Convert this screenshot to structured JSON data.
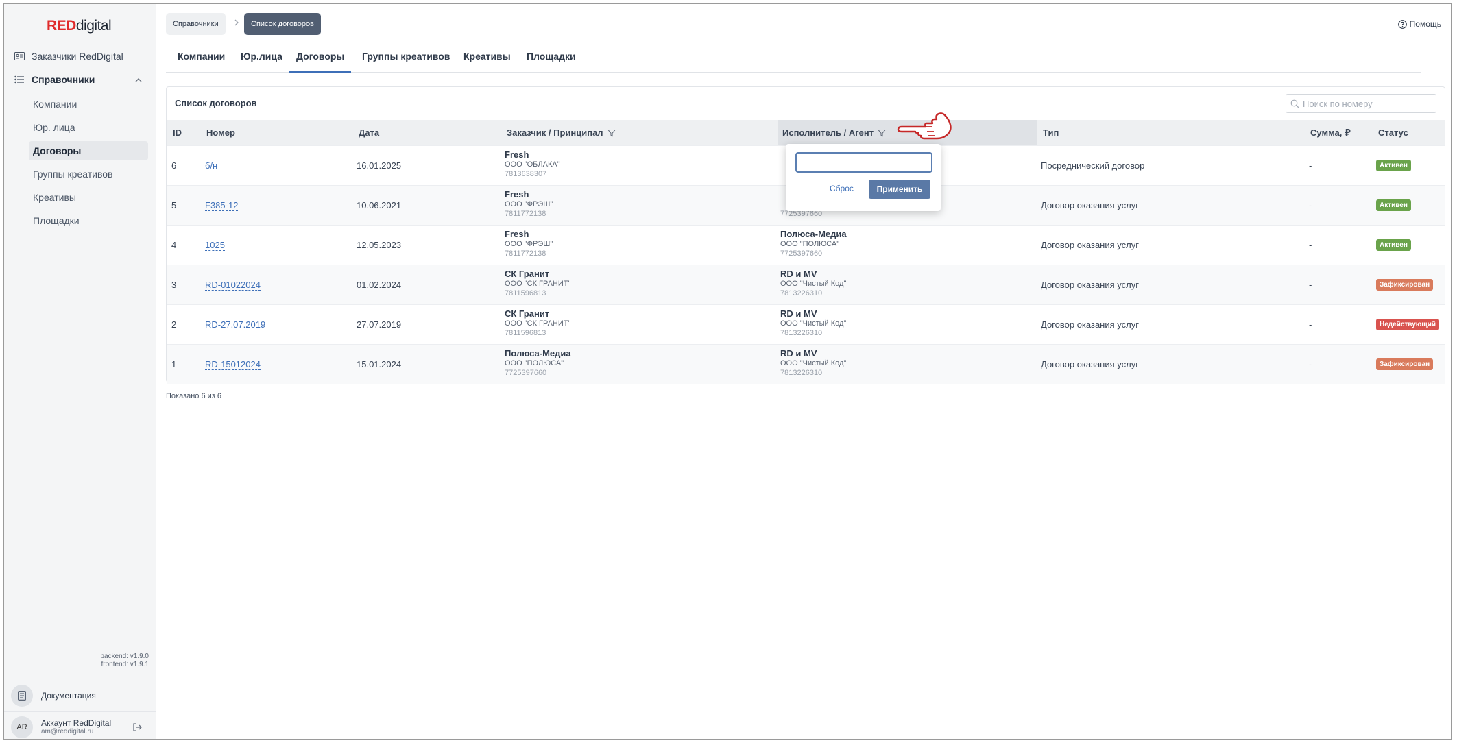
{
  "brand": {
    "logo_red": "RED",
    "logo_rest": "digital"
  },
  "sidebar": {
    "customers_label": "Заказчики RedDigital",
    "group_label": "Справочники",
    "items": [
      {
        "label": "Компании"
      },
      {
        "label": "Юр. лица"
      },
      {
        "label": "Договоры"
      },
      {
        "label": "Группы креативов"
      },
      {
        "label": "Креативы"
      },
      {
        "label": "Площадки"
      }
    ],
    "backend_version": "backend: v1.9.0",
    "frontend_version": "frontend: v1.9.1",
    "docs_label": "Документация",
    "account_initials": "AR",
    "account_name": "Аккаунт RedDigital",
    "account_email": "am@reddigital.ru"
  },
  "breadcrumb": {
    "root": "Справочники",
    "current": "Список договоров"
  },
  "help_label": "Помощь",
  "tabs": [
    {
      "label": "Компании"
    },
    {
      "label": "Юр.лица"
    },
    {
      "label": "Договоры"
    },
    {
      "label": "Группы креативов"
    },
    {
      "label": "Креативы"
    },
    {
      "label": "Площадки"
    }
  ],
  "card": {
    "title": "Список договоров",
    "search_placeholder": "Поиск по номеру"
  },
  "columns": {
    "id": "ID",
    "number": "Номер",
    "date": "Дата",
    "customer": "Заказчик / Принципал",
    "executor": "Исполнитель / Агент",
    "type": "Тип",
    "sum": "Сумма, ₽",
    "status": "Статус"
  },
  "rows": [
    {
      "id": "6",
      "number": "б/н",
      "date": "16.01.2025",
      "customer": {
        "name": "Fresh",
        "legal": "ООО \"ОБЛАКА\"",
        "inn": "7813638307"
      },
      "executor": {
        "name": "",
        "legal": "",
        "inn": ""
      },
      "type": "Посреднический договор",
      "sum": "-",
      "status": "Активен"
    },
    {
      "id": "5",
      "number": "F385-12",
      "date": "10.06.2021",
      "customer": {
        "name": "Fresh",
        "legal": "ООО \"ФРЭШ\"",
        "inn": "7811772138"
      },
      "executor": {
        "name": "",
        "legal": "",
        "inn": "7725397660"
      },
      "type": "Договор оказания услуг",
      "sum": "-",
      "status": "Активен"
    },
    {
      "id": "4",
      "number": "1025",
      "date": "12.05.2023",
      "customer": {
        "name": "Fresh",
        "legal": "ООО \"ФРЭШ\"",
        "inn": "7811772138"
      },
      "executor": {
        "name": "Полюса-Медиа",
        "legal": "ООО \"ПОЛЮСА\"",
        "inn": "7725397660"
      },
      "type": "Договор оказания услуг",
      "sum": "-",
      "status": "Активен"
    },
    {
      "id": "3",
      "number": "RD-01022024",
      "date": "01.02.2024",
      "customer": {
        "name": "СК Гранит",
        "legal": "ООО \"СК ГРАНИТ\"",
        "inn": "7811596813"
      },
      "executor": {
        "name": "RD и MV",
        "legal": "ООО \"Чистый Код\"",
        "inn": "7813226310"
      },
      "type": "Договор оказания услуг",
      "sum": "-",
      "status": "Зафиксирован"
    },
    {
      "id": "2",
      "number": "RD-27.07.2019",
      "date": "27.07.2019",
      "customer": {
        "name": "СК Гранит",
        "legal": "ООО \"СК ГРАНИТ\"",
        "inn": "7811596813"
      },
      "executor": {
        "name": "RD и MV",
        "legal": "ООО \"Чистый Код\"",
        "inn": "7813226310"
      },
      "type": "Договор оказания услуг",
      "sum": "-",
      "status": "Недействующий"
    },
    {
      "id": "1",
      "number": "RD-15012024",
      "date": "15.01.2024",
      "customer": {
        "name": "Полюса-Медиа",
        "legal": "ООО \"ПОЛЮСА\"",
        "inn": "7725397660"
      },
      "executor": {
        "name": "RD и MV",
        "legal": "ООО \"Чистый Код\"",
        "inn": "7813226310"
      },
      "type": "Договор оказания услуг",
      "sum": "-",
      "status": "Зафиксирован"
    }
  ],
  "shown_label": "Показано 6 из 6",
  "filter_popup": {
    "value": "",
    "reset_label": "Сброс",
    "apply_label": "Применить"
  },
  "colors": {
    "status_active": "#6aa34b",
    "status_fixed": "#d97b5c",
    "status_inactive": "#d9534f",
    "accent": "#3d6fb8",
    "brand_red": "#e02b2b"
  }
}
